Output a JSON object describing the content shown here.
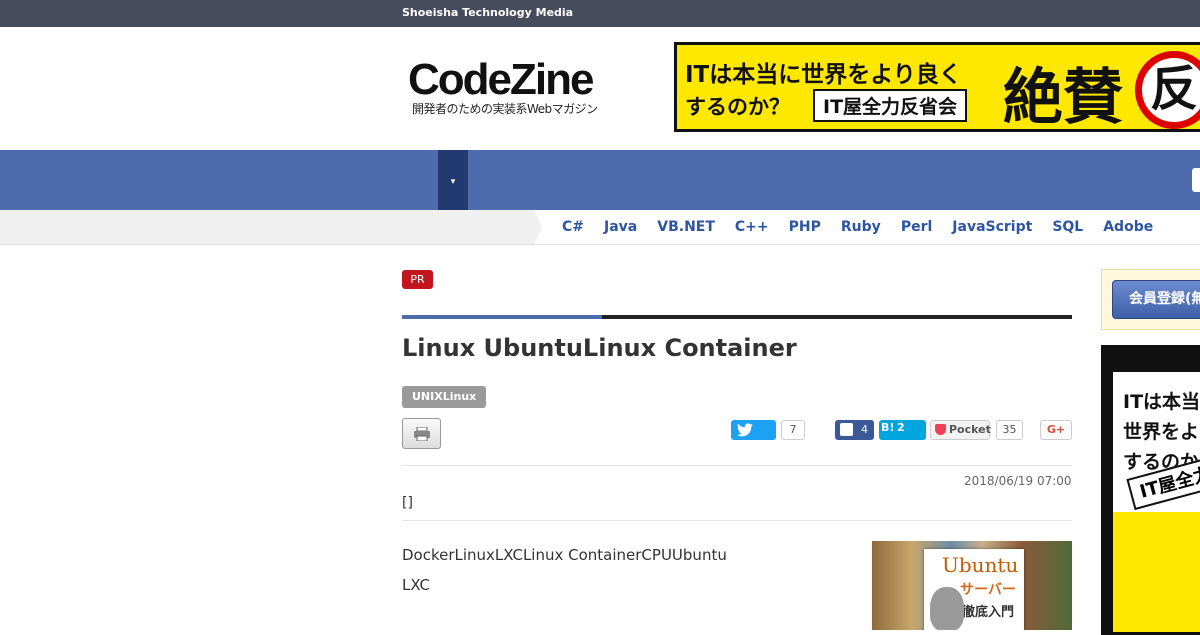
{
  "topbar": {
    "title": "Shoeisha Technology Media"
  },
  "header": {
    "logo": {
      "main": "CodeZine",
      "tagline": "開発者のための実装系Webマガジン"
    },
    "banner": {
      "line1": "ITは本当に世界をより良く",
      "line2": "するのか？",
      "boxed": "IT屋全力反省会",
      "big": "絶賛",
      "stamp": "反"
    }
  },
  "nav": {
    "dropdown_icon": "▾"
  },
  "languages": [
    "C#",
    "Java",
    "VB.NET",
    "C++",
    "PHP",
    "Ruby",
    "Perl",
    "JavaScript",
    "SQL",
    "Adobe"
  ],
  "article": {
    "badge": "PR",
    "title": "Linux UbuntuLinux Container",
    "tag": "UNIXLinux",
    "date": "2018/06/19 07:00",
    "author": "[]",
    "lead_line1": "DockerLinuxLXCLinux ContainerCPUUbuntu",
    "lead_line2": "LXC",
    "book": {
      "title1": "Ubuntu",
      "title2": "サーバー",
      "title3": "徹底入門"
    }
  },
  "social": {
    "twitter_count": "7",
    "facebook_count": "4",
    "hatena_label": "B!",
    "hatena_count": "2",
    "pocket_label": "Pocket",
    "pocket_count": "35",
    "gplus_label": "G+"
  },
  "sidebar": {
    "register_label": "会員登録(無",
    "ad_lines": [
      "ITは本当",
      "世界をよ",
      "するのか"
    ],
    "ad_box": "IT屋全力"
  },
  "colors": {
    "topbar": "#474c5c",
    "nav": "#4c6cae",
    "nav_dark": "#233a70",
    "link": "#2d55a0",
    "pr_red": "#c2151e",
    "banner_yellow": "#ffe800"
  }
}
